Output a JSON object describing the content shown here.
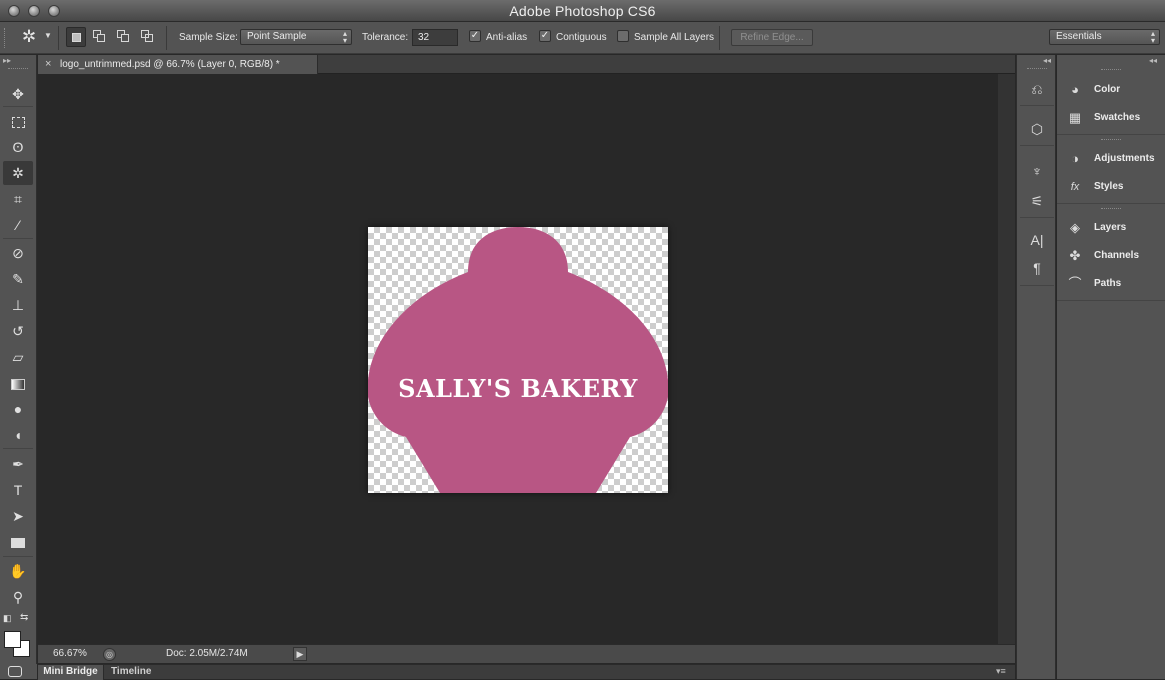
{
  "window": {
    "app_title": "Adobe Photoshop CS6"
  },
  "options_bar": {
    "sample_size_label": "Sample Size:",
    "sample_size_value": "Point Sample",
    "tolerance_label": "Tolerance:",
    "tolerance_value": "32",
    "anti_alias_label": "Anti-alias",
    "anti_alias_checked": true,
    "contiguous_label": "Contiguous",
    "contiguous_checked": true,
    "sample_all_layers_label": "Sample All Layers",
    "sample_all_layers_checked": false,
    "refine_edge_label": "Refine Edge...",
    "workspace_value": "Essentials"
  },
  "tools": [
    "move-icon",
    "marquee-icon",
    "lasso-icon",
    "magic-wand-icon",
    "crop-icon",
    "eyedropper-icon",
    "healing-brush-icon",
    "brush-icon",
    "clone-stamp-icon",
    "history-brush-icon",
    "eraser-icon",
    "gradient-icon",
    "blur-icon",
    "dodge-icon",
    "pen-icon",
    "type-icon",
    "path-selection-icon",
    "rectangle-icon",
    "hand-icon",
    "zoom-icon"
  ],
  "document": {
    "tab_title": "logo_untrimmed.psd @ 66.7% (Layer 0, RGB/8) *",
    "close_glyph": "×",
    "image_text": "SALLY'S BAKERY",
    "shape_color": "#b85684"
  },
  "status": {
    "zoom": "66.67%",
    "doc_size": "Doc: 2.05M/2.74M"
  },
  "bottom_tabs": [
    "Mini Bridge",
    "Timeline"
  ],
  "panels": [
    {
      "label": "Color",
      "icon": "color-palette-icon"
    },
    {
      "label": "Swatches",
      "icon": "swatches-grid-icon"
    },
    {
      "label": "Adjustments",
      "icon": "adjustments-icon"
    },
    {
      "label": "Styles",
      "icon": "styles-fx-icon"
    },
    {
      "label": "Layers",
      "icon": "layers-icon"
    },
    {
      "label": "Channels",
      "icon": "channels-icon"
    },
    {
      "label": "Paths",
      "icon": "paths-icon"
    }
  ],
  "colors": {
    "foreground": "#ffffff",
    "background": "#ffffff",
    "accent": "#b85684"
  }
}
